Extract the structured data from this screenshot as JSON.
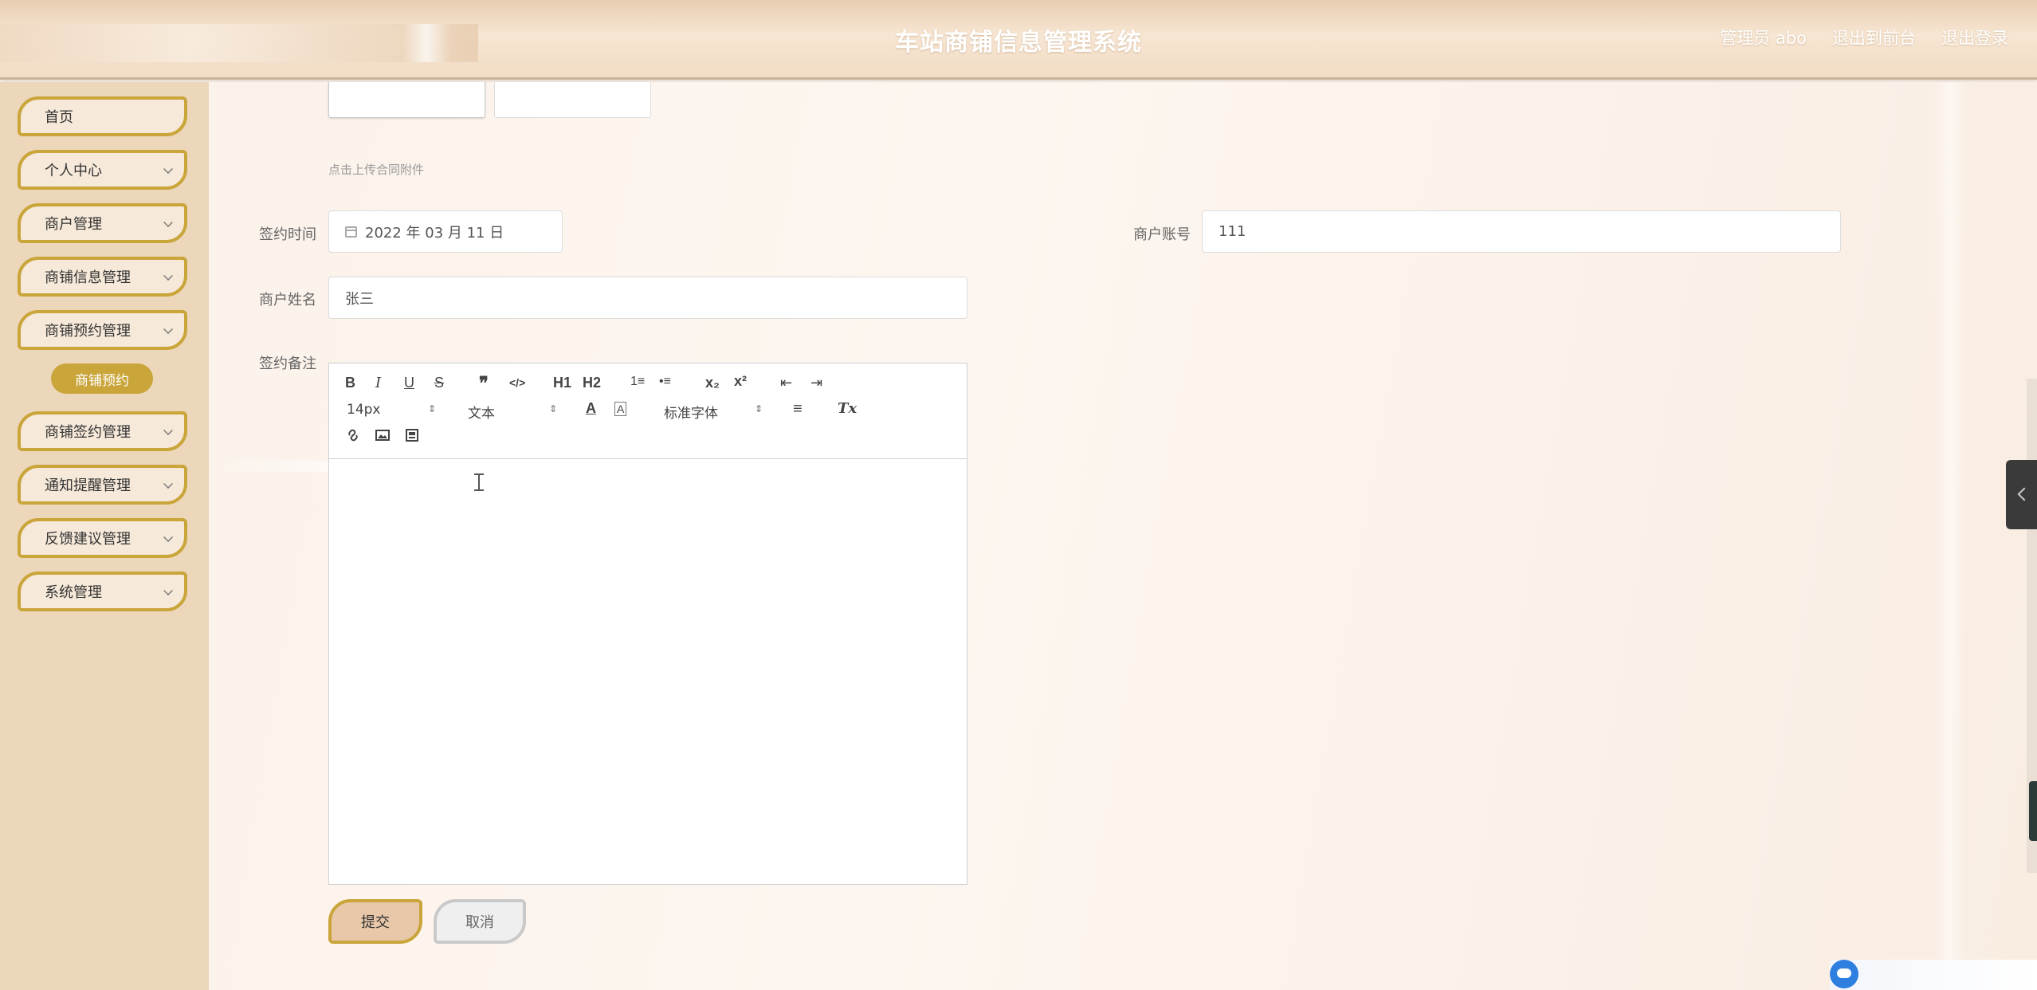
{
  "header": {
    "title": "车站商铺信息管理系统",
    "user": "管理员 abo",
    "to_front": "退出到前台",
    "logout": "退出登录"
  },
  "sidebar": {
    "items": [
      {
        "label": "首页",
        "has_chevron": false
      },
      {
        "label": "个人中心",
        "has_chevron": true
      },
      {
        "label": "商户管理",
        "has_chevron": true
      },
      {
        "label": "商铺信息管理",
        "has_chevron": true
      },
      {
        "label": "商铺预约管理",
        "has_chevron": true
      },
      {
        "label": "商铺签约管理",
        "has_chevron": true
      },
      {
        "label": "通知提醒管理",
        "has_chevron": true
      },
      {
        "label": "反馈建议管理",
        "has_chevron": true
      },
      {
        "label": "系统管理",
        "has_chevron": true
      }
    ],
    "active_sub": "商铺预约"
  },
  "form": {
    "upload_hint": "点击上传合同附件",
    "sign_time_label": "签约时间",
    "sign_time_value": "2022 年 03 月 11 日",
    "merchant_account_label": "商户账号",
    "merchant_account_value": "111",
    "merchant_name_label": "商户姓名",
    "merchant_name_value": "张三",
    "remark_label": "签约备注",
    "remark_value": ""
  },
  "editor": {
    "font_size": "14px",
    "text_style": "文本",
    "font_family": "标准字体",
    "buttons": {
      "bold": "B",
      "italic": "I",
      "underline": "U",
      "strike": "S",
      "quote": "❞",
      "code": "</>",
      "h1": "H1",
      "h2": "H2",
      "ordered_list": "1≡",
      "bullet_list": "•≡",
      "subscript": "x₂",
      "superscript": "x²",
      "outdent": "⇤",
      "indent": "⇥",
      "color": "A",
      "background": "A",
      "align": "≡",
      "clean": "Tx"
    }
  },
  "actions": {
    "submit": "提交",
    "cancel": "取消"
  },
  "colors": {
    "accent": "#c9a53a",
    "sidebar_bg": "#ecd7bb",
    "header_bg": "#f1dcc4"
  }
}
